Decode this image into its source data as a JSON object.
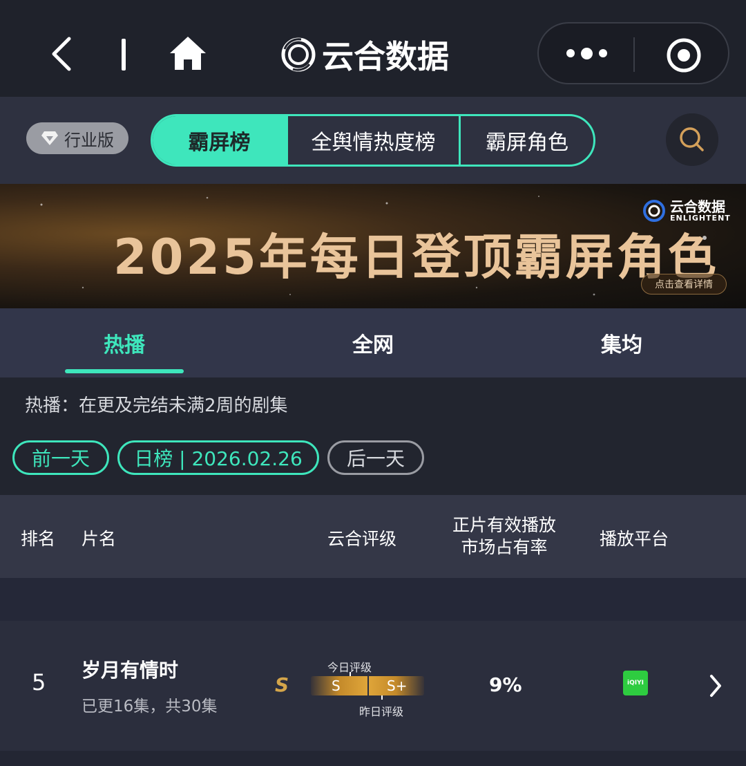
{
  "nav": {
    "title": "云合数据"
  },
  "tabs": {
    "edition_label": "行业版",
    "segments": [
      "霸屏榜",
      "全舆情热度榜",
      "霸屏角色"
    ]
  },
  "banner": {
    "title": "2025年每日登顶霸屏角色",
    "brand_name": "云合数据",
    "brand_sub": "ENLIGHTENT",
    "cta": "点击查看详情"
  },
  "subtabs": [
    "热播",
    "全网",
    "集均"
  ],
  "description": "热播：在更及完结未满2周的剧集",
  "date_nav": {
    "prev": "前一天",
    "current": "日榜 | 2026.02.26",
    "next": "后一天"
  },
  "table": {
    "headers": {
      "rank": "排名",
      "name": "片名",
      "rating": "云合评级",
      "share_line1": "正片有效播放",
      "share_line2": "市场占有率",
      "platform": "播放平台"
    },
    "rows": [
      {
        "rank": "5",
        "title": "岁月有情时",
        "episodes": "已更16集，共30集",
        "grade": "S",
        "today_label": "今日评级",
        "today_grade": "S",
        "yesterday_grade": "S+",
        "yesterday_label": "昨日评级",
        "share": "9%",
        "platform": "iQIYI"
      }
    ]
  },
  "colors": {
    "accent": "#3ee6bc",
    "grade": "#d4a54a",
    "platform": "#2ecc40"
  }
}
